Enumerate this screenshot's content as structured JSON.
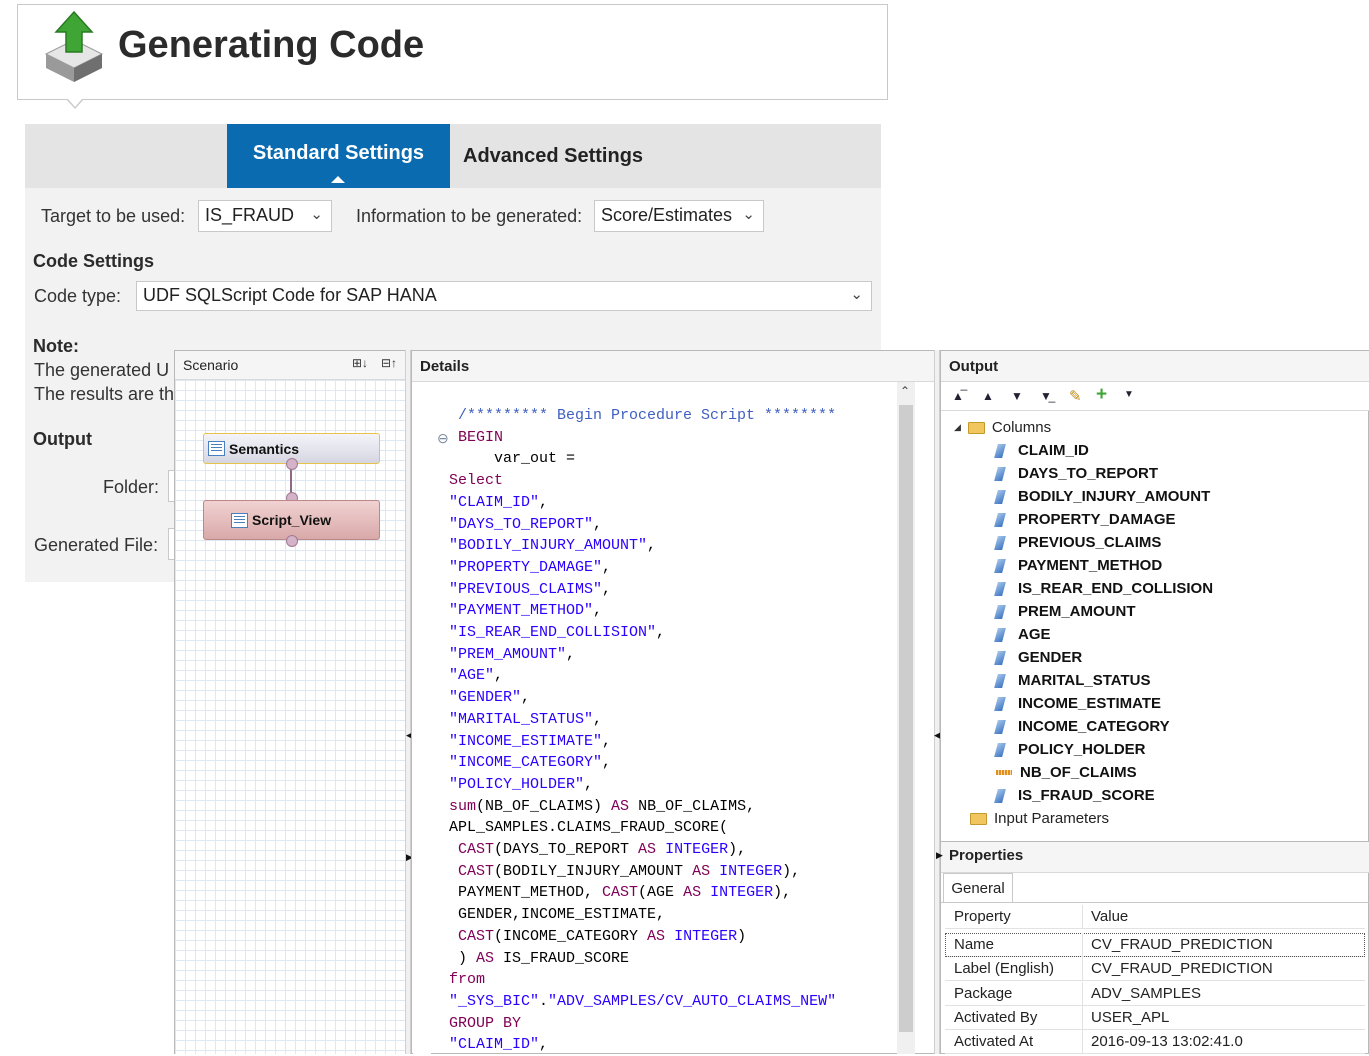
{
  "wizard": {
    "title": "Generating Code",
    "tabs": {
      "standard": "Standard Settings",
      "advanced": "Advanced Settings"
    },
    "target_label": "Target to be used:",
    "target_value": "IS_FRAUD",
    "info_label": "Information to be generated:",
    "info_value": "Score/Estimates",
    "code_settings_heading": "Code Settings",
    "code_type_label": "Code type:",
    "code_type_value": "UDF SQLScript Code for SAP HANA",
    "note_heading": "Note:",
    "note_line1": "The generated U",
    "note_line2": "The results are th",
    "output_heading": "Output",
    "folder_label": "Folder:",
    "generated_file_label": "Generated File:"
  },
  "scenario": {
    "title": "Scenario",
    "nodes": {
      "semantics": "Semantics",
      "script_view": "Script_View"
    }
  },
  "details": {
    "title": "Details",
    "code": [
      [
        {
          "t": "  /********* Begin Procedure Script ********",
          "c": "cm"
        }
      ],
      [
        {
          "t": "  BEGIN",
          "c": "kw"
        }
      ],
      [
        {
          "t": "      var_out =",
          "c": ""
        }
      ],
      [
        {
          "t": " Select",
          "c": "kw"
        }
      ],
      [
        {
          "t": " \"CLAIM_ID\"",
          "c": "st"
        },
        {
          "t": ",",
          "c": ""
        }
      ],
      [
        {
          "t": " \"DAYS_TO_REPORT\"",
          "c": "st"
        },
        {
          "t": ",",
          "c": ""
        }
      ],
      [
        {
          "t": " \"BODILY_INJURY_AMOUNT\"",
          "c": "st"
        },
        {
          "t": ",",
          "c": ""
        }
      ],
      [
        {
          "t": " \"PROPERTY_DAMAGE\"",
          "c": "st"
        },
        {
          "t": ",",
          "c": ""
        }
      ],
      [
        {
          "t": " \"PREVIOUS_CLAIMS\"",
          "c": "st"
        },
        {
          "t": ",",
          "c": ""
        }
      ],
      [
        {
          "t": " \"PAYMENT_METHOD\"",
          "c": "st"
        },
        {
          "t": ",",
          "c": ""
        }
      ],
      [
        {
          "t": " \"IS_REAR_END_COLLISION\"",
          "c": "st"
        },
        {
          "t": ",",
          "c": ""
        }
      ],
      [
        {
          "t": " \"PREM_AMOUNT\"",
          "c": "st"
        },
        {
          "t": ",",
          "c": ""
        }
      ],
      [
        {
          "t": " \"AGE\"",
          "c": "st"
        },
        {
          "t": ",",
          "c": ""
        }
      ],
      [
        {
          "t": " \"GENDER\"",
          "c": "st"
        },
        {
          "t": ",",
          "c": ""
        }
      ],
      [
        {
          "t": " \"MARITAL_STATUS\"",
          "c": "st"
        },
        {
          "t": ",",
          "c": ""
        }
      ],
      [
        {
          "t": " \"INCOME_ESTIMATE\"",
          "c": "st"
        },
        {
          "t": ",",
          "c": ""
        }
      ],
      [
        {
          "t": " \"INCOME_CATEGORY\"",
          "c": "st"
        },
        {
          "t": ",",
          "c": ""
        }
      ],
      [
        {
          "t": " \"POLICY_HOLDER\"",
          "c": "st"
        },
        {
          "t": ",",
          "c": ""
        }
      ],
      [
        {
          "t": " sum",
          "c": "kw"
        },
        {
          "t": "(NB_OF_CLAIMS) ",
          "c": ""
        },
        {
          "t": "AS",
          "c": "kw"
        },
        {
          "t": " NB_OF_CLAIMS,",
          "c": ""
        }
      ],
      [
        {
          "t": " APL_SAMPLES.CLAIMS_FRAUD_SCORE(",
          "c": ""
        }
      ],
      [
        {
          "t": "  CAST",
          "c": "kw"
        },
        {
          "t": "(DAYS_TO_REPORT ",
          "c": ""
        },
        {
          "t": "AS",
          "c": "kw"
        },
        {
          "t": " ",
          "c": ""
        },
        {
          "t": "INTEGER",
          "c": "ty"
        },
        {
          "t": "),",
          "c": ""
        }
      ],
      [
        {
          "t": "  CAST",
          "c": "kw"
        },
        {
          "t": "(BODILY_INJURY_AMOUNT ",
          "c": ""
        },
        {
          "t": "AS",
          "c": "kw"
        },
        {
          "t": " ",
          "c": ""
        },
        {
          "t": "INTEGER",
          "c": "ty"
        },
        {
          "t": "),",
          "c": ""
        }
      ],
      [
        {
          "t": "  PAYMENT_METHOD, ",
          "c": ""
        },
        {
          "t": "CAST",
          "c": "kw"
        },
        {
          "t": "(AGE ",
          "c": ""
        },
        {
          "t": "AS",
          "c": "kw"
        },
        {
          "t": " ",
          "c": ""
        },
        {
          "t": "INTEGER",
          "c": "ty"
        },
        {
          "t": "),",
          "c": ""
        }
      ],
      [
        {
          "t": "  GENDER,INCOME_ESTIMATE,",
          "c": ""
        }
      ],
      [
        {
          "t": "  CAST",
          "c": "kw"
        },
        {
          "t": "(INCOME_CATEGORY ",
          "c": ""
        },
        {
          "t": "AS",
          "c": "kw"
        },
        {
          "t": " ",
          "c": ""
        },
        {
          "t": "INTEGER",
          "c": "ty"
        },
        {
          "t": ")",
          "c": ""
        }
      ],
      [
        {
          "t": "  ) ",
          "c": ""
        },
        {
          "t": "AS",
          "c": "kw"
        },
        {
          "t": " IS_FRAUD_SCORE",
          "c": ""
        }
      ],
      [
        {
          "t": " from",
          "c": "kw"
        }
      ],
      [
        {
          "t": " \"_SYS_BIC\"",
          "c": "st"
        },
        {
          "t": ".",
          "c": ""
        },
        {
          "t": "\"ADV_SAMPLES/CV_AUTO_CLAIMS_NEW\"",
          "c": "st"
        }
      ],
      [
        {
          "t": " GROUP BY",
          "c": "kw"
        }
      ],
      [
        {
          "t": " \"CLAIM_ID\"",
          "c": "st"
        },
        {
          "t": ",",
          "c": ""
        }
      ]
    ]
  },
  "output": {
    "title": "Output",
    "columns_folder": "Columns",
    "columns": [
      {
        "name": "CLAIM_ID",
        "icon": "attribute-icon"
      },
      {
        "name": "DAYS_TO_REPORT",
        "icon": "attribute-icon"
      },
      {
        "name": "BODILY_INJURY_AMOUNT",
        "icon": "attribute-icon"
      },
      {
        "name": "PROPERTY_DAMAGE",
        "icon": "attribute-icon"
      },
      {
        "name": "PREVIOUS_CLAIMS",
        "icon": "attribute-icon"
      },
      {
        "name": "PAYMENT_METHOD",
        "icon": "attribute-icon"
      },
      {
        "name": "IS_REAR_END_COLLISION",
        "icon": "attribute-icon"
      },
      {
        "name": "PREM_AMOUNT",
        "icon": "attribute-icon"
      },
      {
        "name": "AGE",
        "icon": "attribute-icon"
      },
      {
        "name": "GENDER",
        "icon": "attribute-icon"
      },
      {
        "name": "MARITAL_STATUS",
        "icon": "attribute-icon"
      },
      {
        "name": "INCOME_ESTIMATE",
        "icon": "attribute-icon"
      },
      {
        "name": "INCOME_CATEGORY",
        "icon": "attribute-icon"
      },
      {
        "name": "POLICY_HOLDER",
        "icon": "attribute-icon"
      },
      {
        "name": "NB_OF_CLAIMS",
        "icon": "measure-icon"
      },
      {
        "name": "IS_FRAUD_SCORE",
        "icon": "attribute-icon"
      }
    ],
    "input_parameters_folder": "Input Parameters"
  },
  "properties": {
    "title": "Properties",
    "tab": "General",
    "header": {
      "property": "Property",
      "value": "Value"
    },
    "rows": [
      {
        "property": "Name",
        "value": "CV_FRAUD_PREDICTION"
      },
      {
        "property": "Label (English)",
        "value": "CV_FRAUD_PREDICTION"
      },
      {
        "property": "Package",
        "value": "ADV_SAMPLES"
      },
      {
        "property": "Activated By",
        "value": "USER_APL"
      },
      {
        "property": "Activated At",
        "value": "2016-09-13 13:02:41.0"
      }
    ]
  }
}
